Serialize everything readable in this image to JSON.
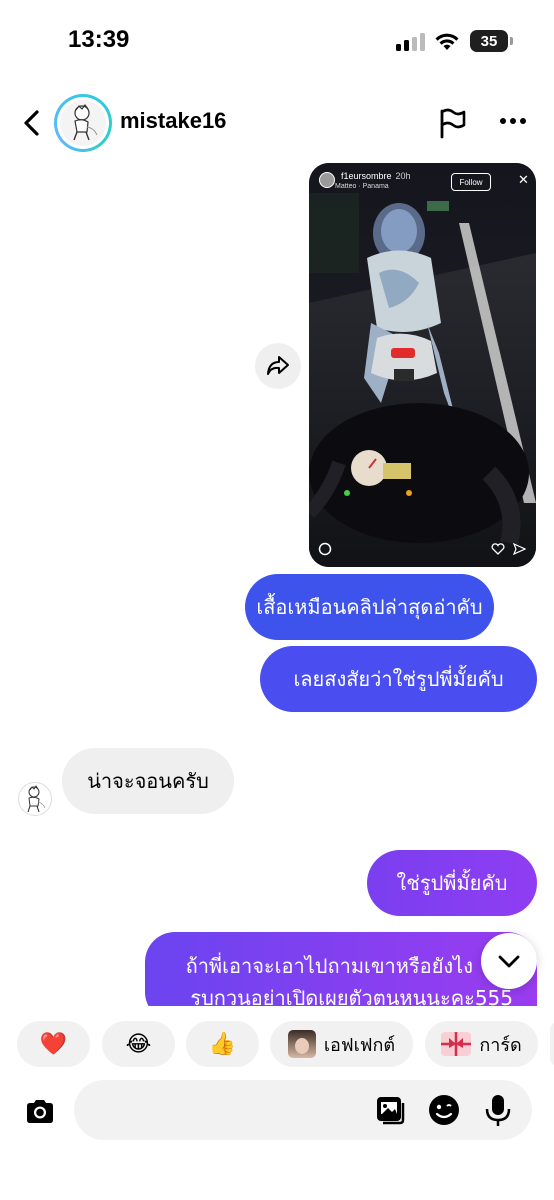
{
  "status_bar": {
    "time": "13:39",
    "battery": "35"
  },
  "header": {
    "username": "mistake16"
  },
  "shared_reel": {
    "username": "f1eursombre",
    "time": "20h",
    "audio": "Matteo · Panama",
    "follow_label": "Follow",
    "close_symbol": "✕"
  },
  "messages": [
    {
      "from": "me",
      "text": "เสื้อเหมือนคลิปล่าสุดอ่าคับ"
    },
    {
      "from": "me",
      "text": "เลยสงสัยว่าใช่รูปพี่มั้ยคับ"
    },
    {
      "from": "them",
      "text": "น่าจะจอนครับ"
    },
    {
      "from": "me",
      "text": "ใช่รูปพี่มั้ยคับ"
    },
    {
      "from": "me",
      "line1": "ถ้าพี่เอาจะเอาไปถามเขาหรือยังไง",
      "line2": "รบกวนอย่าเปิดเผยตัวตนหนูนะคะ555"
    }
  ],
  "quick_reactions": [
    {
      "emoji": "❤️"
    },
    {
      "emoji": "😂"
    },
    {
      "emoji": "👍"
    },
    {
      "label": "เอฟเฟกต์"
    },
    {
      "label": "การ์ด"
    }
  ],
  "composer": {
    "placeholder": ""
  },
  "colors": {
    "sent_bubble_blue": "#3d53ec",
    "sent_bubble_purple": "#8f3df2",
    "received_bubble": "#efefef",
    "avatar_ring": "#34c7e8"
  },
  "icons": [
    "back-arrow-icon",
    "flag-icon",
    "more-icon",
    "share-icon",
    "chevron-down-icon",
    "camera-icon",
    "gallery-icon",
    "sticker-icon",
    "microphone-icon"
  ]
}
